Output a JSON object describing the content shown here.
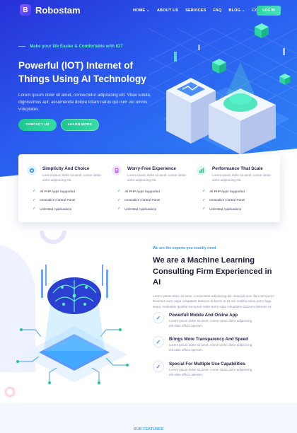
{
  "brand": {
    "name": "Robostam",
    "mark": "B"
  },
  "nav": {
    "items": [
      {
        "label": "HOME",
        "dropdown": true
      },
      {
        "label": "ABOUT US",
        "dropdown": false
      },
      {
        "label": "SERVICES",
        "dropdown": false
      },
      {
        "label": "FAQ",
        "dropdown": false
      },
      {
        "label": "BLOG",
        "dropdown": true
      },
      {
        "label": "CONTACT",
        "dropdown": false
      }
    ],
    "login_label": "LOG IN"
  },
  "hero": {
    "tagline": "Make your life Easier & Comfortable with IOT",
    "headline_line1": "Powerful (IOT) Internet of",
    "headline_line2": "Things Using AI Technology",
    "subtext": "Lorem ipsum dolor sit amet, consectetur adipisicing elit. Vitae soluta, dignissimos aut, assumenda dolore totam natus qui cum vel omnis voluptates.",
    "contact_label": "CONTACT US",
    "learn_label": "LEARN MORE"
  },
  "features": [
    {
      "title": "Simplicity And Choice",
      "desc": "Lorem ipsum dolor sit amet, conse ctetur dolor adipisicing elit.",
      "icon": "target-icon",
      "icon_color": "#e3f2ff",
      "items": [
        "All PHP Apps Supported",
        "Innovative Control Panel",
        "Unlimited Applications"
      ]
    },
    {
      "title": "Worry-Free Experience",
      "desc": "Lorem ipsum dolor sit amet, conse ctetur dolor adipisicing elit.",
      "icon": "document-icon",
      "icon_color": "#f6e6ff",
      "items": [
        "All PHP Apps Supported",
        "Innovative Control Panel",
        "Unlimited Applications"
      ]
    },
    {
      "title": "Performance That Scale",
      "desc": "Lorem ipsum dolor sit amet, conse ctetur dolor adipisicing elit.",
      "icon": "chart-icon",
      "icon_color": "#e2f8ef",
      "items": [
        "All PHP Apps Supported",
        "Innovative Control Panel",
        "Unlimited Applications"
      ]
    }
  ],
  "ml": {
    "eyebrow": "We are the experts you exactly need",
    "title_line1": "We are a Machine Learning",
    "title_line2": "Consulting Firm Experienced in AI",
    "desc": "Lorem ipsum dolor sit amet, consectetur adipisicing elit. Suscipit eum illum tempora? Ducimus eum culpa voluptates dolorum dolorem et sit nisi mollitia animi porro fuga sequi, molestias repellat excepturi nobis eum culpa voluptates dolorum dolorem et.",
    "items": [
      {
        "title": "Powerfull Mobile And Online App",
        "desc": "Lorem ipsum dolor sit amet, conse ctetur dolor adipisicing elit alias officia operam."
      },
      {
        "title": "Brings More Transparency And Speed",
        "desc": "Lorem ipsum dolor sit amet, conse ctetur dolor adipisicing elit alias officia operam."
      },
      {
        "title": "Special For Multiple Use Capabilities",
        "desc": "Lorem ipsum dolor sit amet, conse ctetur dolor adipisicing elit alias officia operam."
      }
    ]
  },
  "bottom": {
    "section_label": "OUR FEATURES"
  },
  "colors": {
    "accent_green": "#1ec78f",
    "hero_blue": "#2a5ff0",
    "eyebrow_blue": "#3d9ef0"
  }
}
